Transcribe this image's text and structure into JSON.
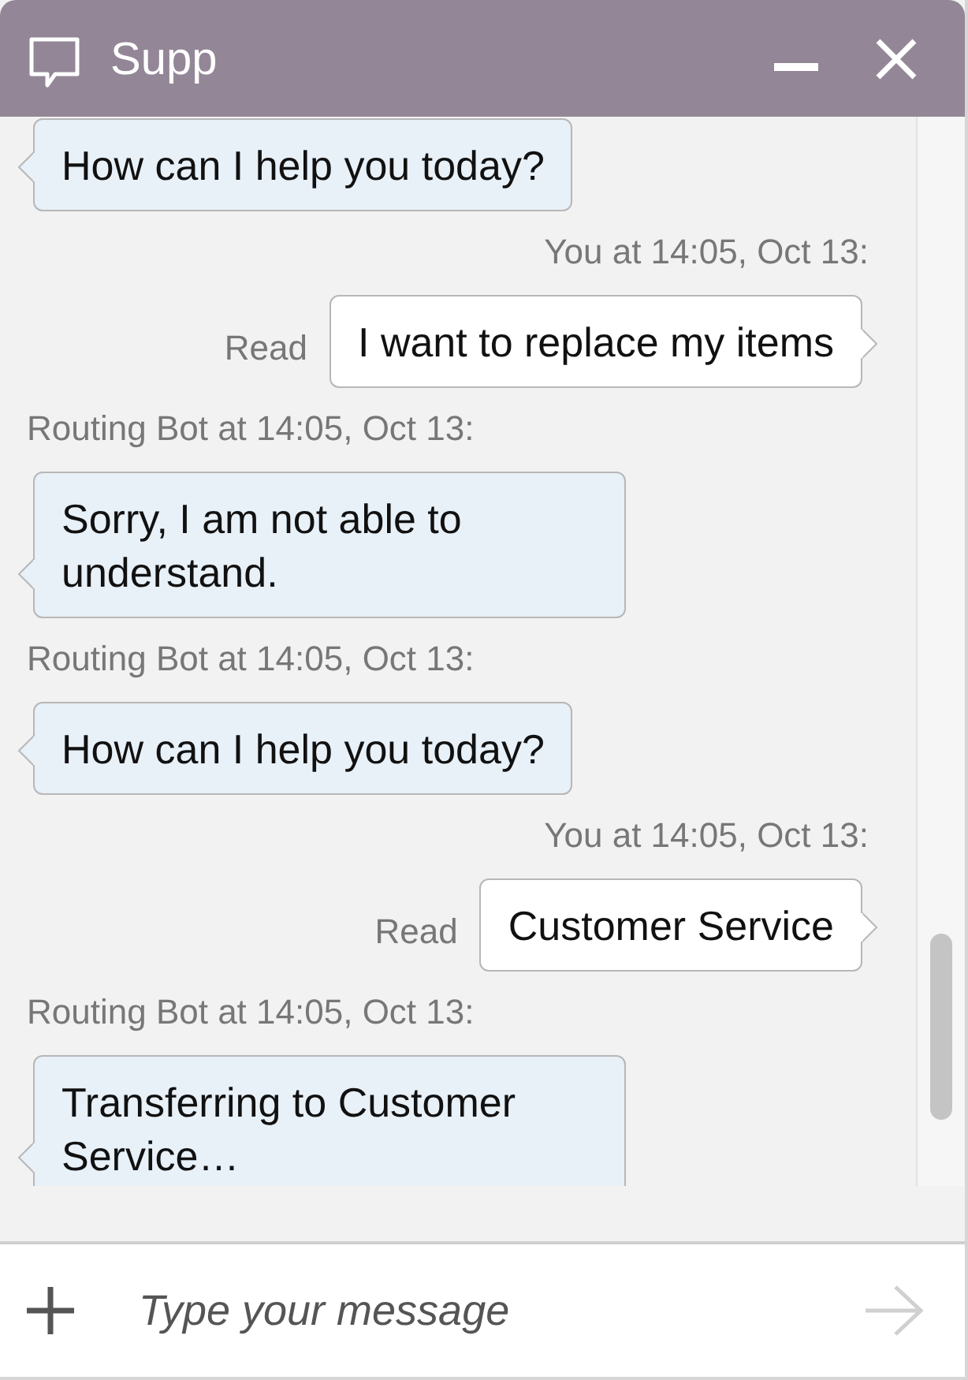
{
  "window": {
    "title": "Supp"
  },
  "messages": [
    {
      "kind": "bot",
      "text": "How can I help you today?"
    },
    {
      "kind": "user",
      "header": "You at 14:05, Oct 13:",
      "text": "I want to replace my items",
      "receipt": "Read"
    },
    {
      "kind": "bot",
      "header": "Routing Bot at 14:05, Oct 13:",
      "text": "Sorry, I am not able to understand."
    },
    {
      "kind": "bot",
      "header": "Routing Bot at 14:05, Oct 13:",
      "text": "How can I help you today?"
    },
    {
      "kind": "user",
      "header": "You at 14:05, Oct 13:",
      "text": "Customer Service",
      "receipt": "Read"
    },
    {
      "kind": "bot",
      "header": "Routing Bot at 14:05, Oct 13:",
      "text": "Transferring to Customer Service…"
    }
  ],
  "composer": {
    "placeholder": "Type your message"
  }
}
